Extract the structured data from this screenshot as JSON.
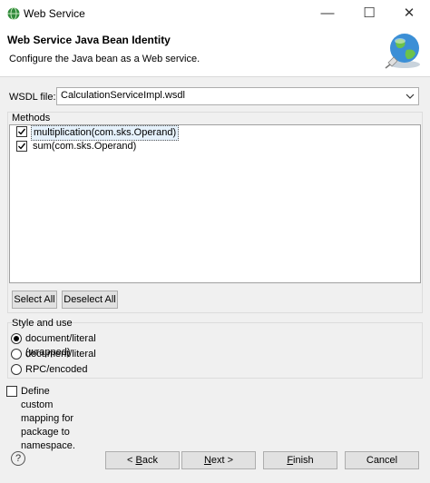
{
  "window": {
    "title": "Web Service",
    "minimize_glyph": "—",
    "maximize_glyph": "☐",
    "close_glyph": "✕"
  },
  "banner": {
    "title": "Web Service Java Bean Identity",
    "description": "Configure the Java bean as a Web service.",
    "icon": "globe-plug-icon"
  },
  "wsdl": {
    "label": "WSDL file:",
    "value": "CalculationServiceImpl.wsdl"
  },
  "methods": {
    "legend": "Methods",
    "items": [
      {
        "label": "multiplication(com.sks.Operand)",
        "checked": true
      },
      {
        "label": "sum(com.sks.Operand)",
        "checked": true
      }
    ],
    "select_all": "Select All",
    "deselect_all": "Deselect All"
  },
  "style": {
    "legend": "Style and use",
    "options": [
      {
        "label": "document/literal (wrapped)",
        "selected": true
      },
      {
        "label": "document/literal",
        "selected": false
      },
      {
        "label": "RPC/encoded",
        "selected": false
      }
    ]
  },
  "custom_mapping": {
    "label": "Define custom mapping for package to namespace.",
    "checked": false
  },
  "footer": {
    "help_glyph": "?",
    "back_prefix": "< ",
    "back_mnemonic": "B",
    "back_rest": "ack",
    "next_mnemonic": "N",
    "next_rest": "ext >",
    "finish_mnemonic": "F",
    "finish_rest": "inish",
    "cancel": "Cancel"
  }
}
